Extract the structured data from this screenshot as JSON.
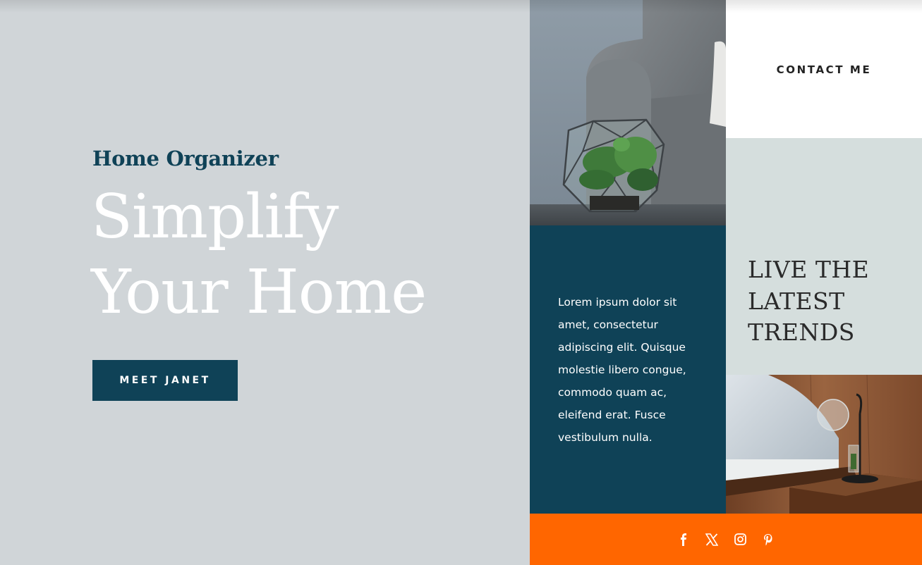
{
  "hero": {
    "eyebrow": "Home Organizer",
    "headline_line1": "Simplify",
    "headline_line2": "Your Home",
    "cta_label": "MEET JANET"
  },
  "nav": {
    "contact_label": "CONTACT ME"
  },
  "feature": {
    "body": "Lorem ipsum dolor sit amet, consectetur adipiscing elit. Quisque molestie libero congue, commodo quam ac, eleifend erat. Fusce vestibulum nulla.",
    "trends_line1": "LIVE THE",
    "trends_line2": "LATEST",
    "trends_line3": "TRENDS"
  },
  "images": {
    "terrarium": "terrarium-image",
    "bedroom": "bedroom-image"
  },
  "social": {
    "icons": [
      "facebook-icon",
      "x-icon",
      "instagram-icon",
      "pinterest-icon"
    ]
  },
  "colors": {
    "hero_bg": "#d0d5d8",
    "brand_navy": "#0f4257",
    "accent_orange": "#ff6600",
    "trends_bg": "#d5dedd",
    "white": "#ffffff"
  }
}
